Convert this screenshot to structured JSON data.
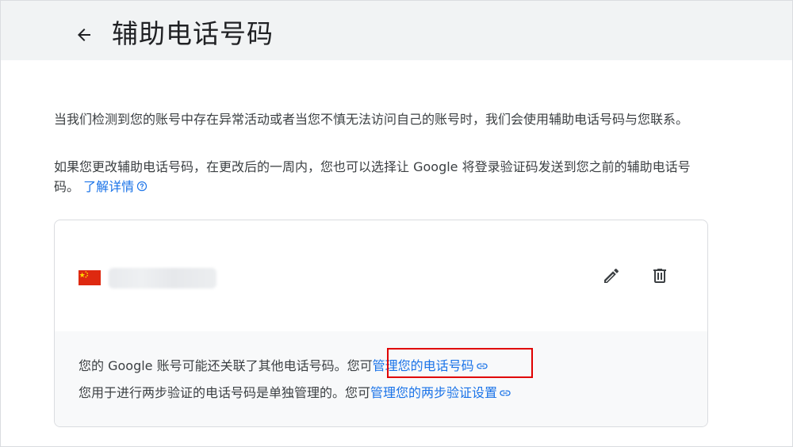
{
  "header": {
    "title": "辅助电话号码",
    "back_icon": "arrow-back-icon"
  },
  "description": {
    "paragraph1": "当我们检测到您的账号中存在异常活动或者当您不慎无法访问自己的账号时，我们会使用辅助电话号码与您联系。",
    "paragraph2_text": "如果您更改辅助电话号码，在更改后的一周内，您也可以选择让 Google 将登录验证码发送到您之前的辅助电话号码。",
    "learn_more_link": "了解详情"
  },
  "phone_card": {
    "country_flag": "china-flag-icon",
    "phone_number_blurred": true,
    "edit_icon": "pencil-icon",
    "delete_icon": "trash-icon"
  },
  "notes": {
    "note1_text": "您的 Google 账号可能还关联了其他电话号码。您可",
    "note1_link": "管理您的电话号码",
    "note2_text": "您用于进行两步验证的电话号码是单独管理的。您可",
    "note2_link": "管理您的两步验证设置"
  },
  "colors": {
    "accent": "#1a73e8",
    "header_bg": "#f1f3f4",
    "highlight": "#e00000"
  }
}
